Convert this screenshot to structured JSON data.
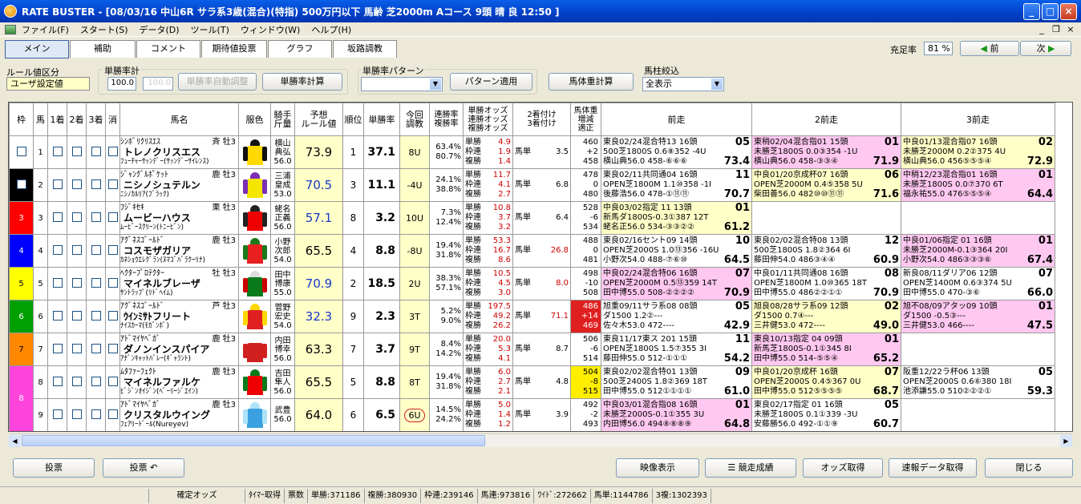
{
  "window": {
    "title": "RATE BUSTER - [08/03/16 中山6R サラ系3歳(混合)(特指) 500万円以下 馬齢 芝2000m Aコース 9頭 晴 良 12:50 ]"
  },
  "menu": [
    "ファイル(F)",
    "スタート(S)",
    "データ(D)",
    "ツール(T)",
    "ウィンドウ(W)",
    "ヘルプ(H)"
  ],
  "tabs": [
    "メイン",
    "補助",
    "コメント",
    "期待値投票",
    "グラフ",
    "坂路調教"
  ],
  "fill_rate": {
    "label": "充足率",
    "value": "81 %"
  },
  "nav": {
    "prev": "前",
    "next": "次"
  },
  "rule_group": {
    "label": "ルール値区分",
    "value": "ユーザ設定値"
  },
  "win_total": {
    "label": "単勝率計",
    "value": "100.0",
    "value2": "100.0",
    "auto_btn": "単勝率自動調整",
    "calc_btn": "単勝率計算"
  },
  "pattern": {
    "label": "単勝率パターン",
    "value": "",
    "apply_btn": "パターン適用"
  },
  "weight_btn": "馬体重計算",
  "filter": {
    "label": "馬柱絞込",
    "value": "全表示"
  },
  "headers": {
    "waku": "枠",
    "uma": "馬",
    "c1": "1着",
    "c2": "2着",
    "c3": "3着",
    "kesu": "消",
    "name": "馬名",
    "fuku": "服色",
    "jockey": "騎手\n斤量",
    "rule": "予想\nルール値",
    "rank": "順位",
    "win": "単勝率",
    "chg": "今回\n調教",
    "rate": "連勝率\n複勝率",
    "odds": "単勝オッズ\n連勝オッズ\n複勝オッズ",
    "sec": "2着付け\n3着付け",
    "wt": "馬体重\n増減\n適正",
    "p1": "前走",
    "p2": "2前走",
    "p3": "3前走"
  },
  "rows": [
    {
      "waku": "1",
      "uma": "1",
      "sire": "ｼﾝﾎﾞﾘｸﾘｽｴｽ",
      "trainer": "斉",
      "sex": "牡3",
      "name": "トレノクリスエス",
      "dam": "ﾌｭｰﾁｬｰｻｯﾝﾃﾞｰ(ｻｯﾝﾃﾞｰｻｲﾚﾝｽ)",
      "j1": "横山",
      "j2": "典弘",
      "jw": "56.0",
      "rule": "73.9",
      "rank": "1",
      "win": "37.1",
      "chg": "8U",
      "r1": "63.4%",
      "r2": "80.7%",
      "o1": "4.9",
      "o2": "1.9",
      "o3": "1.4",
      "sl": "馬単",
      "sv": "3.5",
      "w1": "460",
      "w2": "+2",
      "w3": "458",
      "p1": {
        "a": "東良02/24混合特13 16頭",
        "b": "05",
        "c": "500芝1800S 0.6⑧352 -4U",
        "d": "横山典56.0 458-⑥⑥⑥",
        "e": "73.4"
      },
      "p2": {
        "a": "東稍02/04混合指01 15頭",
        "b": "01",
        "c": "未勝芝1800S 0.0③354 -1U",
        "d": "横山典56.0 458-③③④",
        "e": "71.9"
      },
      "p3": {
        "a": "中良01/13混合指07 16頭",
        "b": "02",
        "c": "未勝芝2000M 0.2②375 4U",
        "d": "横山典56.0 456⑤⑤⑤④",
        "e": "72.9"
      }
    },
    {
      "waku": "2",
      "uma": "2",
      "sire": "ｼﾞｬﾝｸﾞﾙﾎﾟｹｯﾄ",
      "trainer": "鹿",
      "sex": "牡3",
      "name": "ニシノシュテルン",
      "dam": "ﾆｼﾉｶﾙﾘｱ(ﾌﾞﾗｯｸ)",
      "j1": "三浦",
      "j2": "皇成",
      "jw": "53.0",
      "rule": "70.5",
      "rank": "3",
      "win": "11.1",
      "chg": "-4U",
      "r1": "24.1%",
      "r2": "38.8%",
      "o1": "11.7",
      "o2": "4.1",
      "o3": "2.7",
      "sl": "馬単",
      "sv": "6.8",
      "w1": "478",
      "w2": "0",
      "w3": "480",
      "p1": {
        "a": "東良02/11共同通04 16頭",
        "b": "11",
        "c": "OPEN芝1800M 1.1⑩358 -1I",
        "d": "後藤浩56.0 478-①⑪⑪",
        "e": "70.7"
      },
      "p2": {
        "a": "中良01/20京成杯07 16頭",
        "b": "06",
        "c": "OPEN芝2000M 0.4⑤358 5U",
        "d": "柴田善56.0 482⑩⑩⑪⑪",
        "e": "71.6"
      },
      "p3": {
        "a": "中稍12/23混合指01 16頭",
        "b": "01",
        "c": "未勝芝1800S 0.0⑦370 6T",
        "d": "福永祐55.0 476⑤⑤⑤④",
        "e": "64.4"
      }
    },
    {
      "waku": "3",
      "uma": "3",
      "sire": "ﾌｼﾞｷｾｷ",
      "trainer": "栗",
      "sex": "牡3",
      "name": "ムービーハウス",
      "dam": "ﾑｰﾋﾞｰｽｸﾘｰﾝ(ﾄﾆｰﾋﾞﾝ)",
      "j1": "蛯名",
      "j2": "正義",
      "jw": "56.0",
      "rule": "57.1",
      "rank": "8",
      "win": "3.2",
      "chg": "10U",
      "r1": "7.3%",
      "r2": "12.4%",
      "o1": "10.8",
      "o2": "3.7",
      "o3": "3.2",
      "sl": "馬単",
      "sv": "6.4",
      "w1": "528",
      "w2": "-6",
      "w3": "534",
      "p1": {
        "a": "中良03/02指定 11 13頭",
        "b": "01",
        "c": "新馬ダ1800S-0.3①387 12T",
        "d": "蛯名正56.0 534-③③②②",
        "e": "61.2"
      },
      "p2": {
        "a": "",
        "b": "",
        "c": "",
        "d": "",
        "e": ""
      },
      "p3": {
        "a": "",
        "b": "",
        "c": "",
        "d": "",
        "e": ""
      }
    },
    {
      "waku": "4",
      "uma": "4",
      "sire": "ｱｸﾞﾈｽｺﾞｰﾙﾄﾞ",
      "trainer": "鹿",
      "sex": "牡3",
      "name": "コスモザガリア",
      "dam": "ｶﾈｼｮｳｴﾚｸﾞﾗﾝ(ﾇﾏｺﾞﾊﾞﾗｸｰﾘﾅ)",
      "j1": "小野",
      "j2": "次郎",
      "jw": "54.0",
      "rule": "65.5",
      "rank": "4",
      "win": "8.8",
      "chg": "-8U",
      "r1": "19.4%",
      "r2": "31.8%",
      "o1": "53.3",
      "o2": "16.7",
      "o3": "8.6",
      "sl": "馬単",
      "sv": "26.8",
      "w1": "488",
      "w2": "0",
      "w3": "481",
      "p1": {
        "a": "東良02/16セント09 14頭",
        "b": "10",
        "c": "OPEN芝2000S 1.0⑬356 -16U",
        "d": "小野次54.0 488-⑦⑥⑩",
        "e": "64.5"
      },
      "p2": {
        "a": "東良02/02混合特08 13頭",
        "b": "12",
        "c": "500芝1800S 1.8②364 6I",
        "d": "藤田伸54.0 486③④④",
        "e": "60.9"
      },
      "p3": {
        "a": "中良01/06指定 01 16頭",
        "b": "01",
        "c": "未勝芝2000M-0.1③364 20I",
        "d": "小野次54.0 486③③③⑥",
        "e": "67.4"
      }
    },
    {
      "waku": "5",
      "uma": "5",
      "sire": "ﾍｸﾀｰﾌﾟﾛﾃｸﾀｰ",
      "trainer": "牡",
      "sex": "牡3",
      "name": "マイネルブレーザ",
      "dam": "ｻﾝﾄﾗｯﾌﾟ(ﾘﾄﾞﾍｲﾑ)",
      "j1": "田中",
      "j2": "博康",
      "jw": "55.0",
      "rule": "70.9",
      "rank": "2",
      "win": "18.5",
      "chg": "2U",
      "r1": "38.3%",
      "r2": "57.1%",
      "o1": "10.5",
      "o2": "4.5",
      "o3": "3.0",
      "sl": "馬単",
      "sv": "8.0",
      "w1": "498",
      "w2": "-10",
      "w3": "508",
      "p1": {
        "a": "中良02/24混合特06 16頭",
        "b": "07",
        "c": "OPEN芝2000M 0.5⑬359 14T",
        "d": "田中博55.0 508-②②②②",
        "e": "70.9"
      },
      "p2": {
        "a": "中良01/11共同通08 16頭",
        "b": "08",
        "c": "OPEN芝1800M 1.0⑩365 18T",
        "d": "田中博55.0 486②②①①",
        "e": "70.9"
      },
      "p3": {
        "a": "新良08/11ダリア06 12頭",
        "b": "07",
        "c": "OPEN芝1400M 0.6③374 5U",
        "d": "田中博55.0 470-③⑥",
        "e": "66.0"
      }
    },
    {
      "waku": "6",
      "uma": "6",
      "sire": "ｱｸﾞﾈｽｺﾞｰﾙﾄﾞ",
      "trainer": "芦",
      "sex": "牡3",
      "name": "ｳｲﾝﾐｻﾄフリート",
      "dam": "ﾅｲｽｶｰﾏ(ﾓｶﾞﾝﾎﾞ)",
      "j1": "菅野",
      "j2": "宏史",
      "jw": "54.0",
      "rule": "32.3",
      "rank": "9",
      "win": "2.3",
      "chg": "3T",
      "r1": "5.2%",
      "r2": "9.0%",
      "o1": "197.5",
      "o2": "49.2",
      "o3": "26.2",
      "sl": "馬単",
      "sv": "71.1",
      "w1": "486",
      "w2": "+14",
      "w3": "469",
      "p1": {
        "a": "旭重09/11サラ系08 08頭",
        "b": "05",
        "c": "ダ1500 1.2②---",
        "d": "佐々木53.0 472----",
        "e": "42.9"
      },
      "p2": {
        "a": "旭良08/28サラ系09 12頭",
        "b": "02",
        "c": "ダ1500 0.7④---",
        "d": "三井健53.0 472----",
        "e": "49.0"
      },
      "p3": {
        "a": "旭不08/09アタッ09 10頭",
        "b": "01",
        "c": "ダ1500 -0.5③---",
        "d": "三井健53.0 466----",
        "e": "47.5"
      }
    },
    {
      "waku": "7",
      "uma": "7",
      "sire": "ｱﾄﾞﾏｲﾔﾍﾞｶﾞ",
      "trainer": "鹿",
      "sex": "牡3",
      "name": "ダノンインスパイア",
      "dam": "ｱﾅﾞﾝｷｬｯﾄﾊﾞﾚｰ(ｷﾞｬﾗﾝﾄ)",
      "j1": "内田",
      "j2": "博幸",
      "jw": "56.0",
      "rule": "63.3",
      "rank": "7",
      "win": "3.7",
      "chg": "9T",
      "r1": "8.4%",
      "r2": "14.2%",
      "o1": "20.0",
      "o2": "5.3",
      "o3": "4.1",
      "sl": "馬単",
      "sv": "8.7",
      "w1": "506",
      "w2": "-6",
      "w3": "514",
      "p1": {
        "a": "東良11/17東ス 201 15頭",
        "b": "11",
        "c": "OPEN芝1800S 1.5⑦355 3I",
        "d": "藤田伸55.0 512-①①①",
        "e": "54.2"
      },
      "p2": {
        "a": "東良10/13指定 04 09頭",
        "b": "01",
        "c": "新馬芝1800S-0.1①345 8I",
        "d": "田中博55.0 514-⑤⑤④",
        "e": "65.2"
      },
      "p3": {
        "a": "",
        "b": "",
        "c": "",
        "d": "",
        "e": ""
      }
    },
    {
      "waku": "8",
      "uma": "8",
      "sire": "ﾑﾀﾌｧｰﾌｪｸﾄ",
      "trainer": "鹿",
      "sex": "牡3",
      "name": "マイネルファルケ",
      "dam": "ﾋﾞｼﾞﾝｵｲｼﾞﾝ(ﾍﾞｰﾘｰｼﾞｴｲﾝ)",
      "j1": "吉田",
      "j2": "隼人",
      "jw": "56.0",
      "rule": "65.5",
      "rank": "5",
      "win": "8.8",
      "chg": "8T",
      "r1": "19.4%",
      "r2": "31.8%",
      "o1": "6.0",
      "o2": "2.7",
      "o3": "2.1",
      "sl": "馬単",
      "sv": "4.8",
      "w1": "504",
      "w2": "-8",
      "w3": "515",
      "p1": {
        "a": "東良02/02混合特01 13頭",
        "b": "09",
        "c": "500芝2400S 1.8②369 18T",
        "d": "田中博55.0 512①①①①",
        "e": "61.0"
      },
      "p2": {
        "a": "中良01/20京成杯 16頭",
        "b": "07",
        "c": "OPEN芝2000S 0.4⑤367 0U",
        "d": "田中博55.0 512⑤⑤⑤⑤",
        "e": "68.7"
      },
      "p3": {
        "a": "阪重12/22ラ杯06 13頭",
        "b": "05",
        "c": "OPEN芝2000S 0.6⑥380 18I",
        "d": "池添謙55.0 510②②②①",
        "e": "59.3"
      }
    },
    {
      "waku": "8",
      "uma": "9",
      "sire": "ｱﾄﾞﾏｲﾔﾍﾞｶﾞ",
      "trainer": "鹿",
      "sex": "牡3",
      "name": "クリスタルウイング",
      "dam": "ﾌｪｱﾘｰﾄﾞｰﾙ(Nureyev)",
      "j1": "武豊",
      "j2": "",
      "jw": "56.0",
      "rule": "64.0",
      "rank": "6",
      "win": "6.5",
      "chg": "6U",
      "r1": "14.5%",
      "r2": "24.2%",
      "o1": "5.0",
      "o2": "1.4",
      "o3": "1.2",
      "sl": "馬単",
      "sv": "3.9",
      "w1": "492",
      "w2": "-2",
      "w3": "493",
      "p1": {
        "a": "中良03/01混合指08 16頭",
        "b": "01",
        "c": "未勝芝2000S-0.1①355 3U",
        "d": "内田博56.0 494⑧⑧⑧⑨",
        "e": "64.8"
      },
      "p2": {
        "a": "東良02/17指定 01 16頭",
        "b": "05",
        "c": "未勝芝1800S 0.1①339 -3U",
        "d": "安藤勝56.0 492-①①⑨",
        "e": "60.7"
      },
      "p3": {
        "a": "",
        "b": "",
        "c": "",
        "d": "",
        "e": ""
      }
    }
  ],
  "bottom": {
    "vote": "投票",
    "vote2": "投票 ↶",
    "video": "映像表示",
    "results": "競走成績",
    "odds": "オッズ取得",
    "fast": "速報データ取得",
    "close": "閉じる"
  },
  "status": [
    "確定オッズ",
    "ﾀｲﾏｰ取得",
    "票数",
    "単勝:371186",
    "複勝:380930",
    "枠連:239146",
    "馬連:973816",
    "ﾜｲﾄﾞ:272662",
    "馬単:1144786",
    "3複:1302393"
  ],
  "colors": {
    "waku1": "#FFFFFF",
    "waku2": "#000000",
    "waku3": "#FF0000",
    "waku4": "#0000FF",
    "waku5": "#FFFF00",
    "waku6": "#00A000",
    "waku7": "#FF8800",
    "waku8": "#FF44DD",
    "accent_pink": "#FFC8F0",
    "accent_yellow": "#FFFFC8"
  }
}
